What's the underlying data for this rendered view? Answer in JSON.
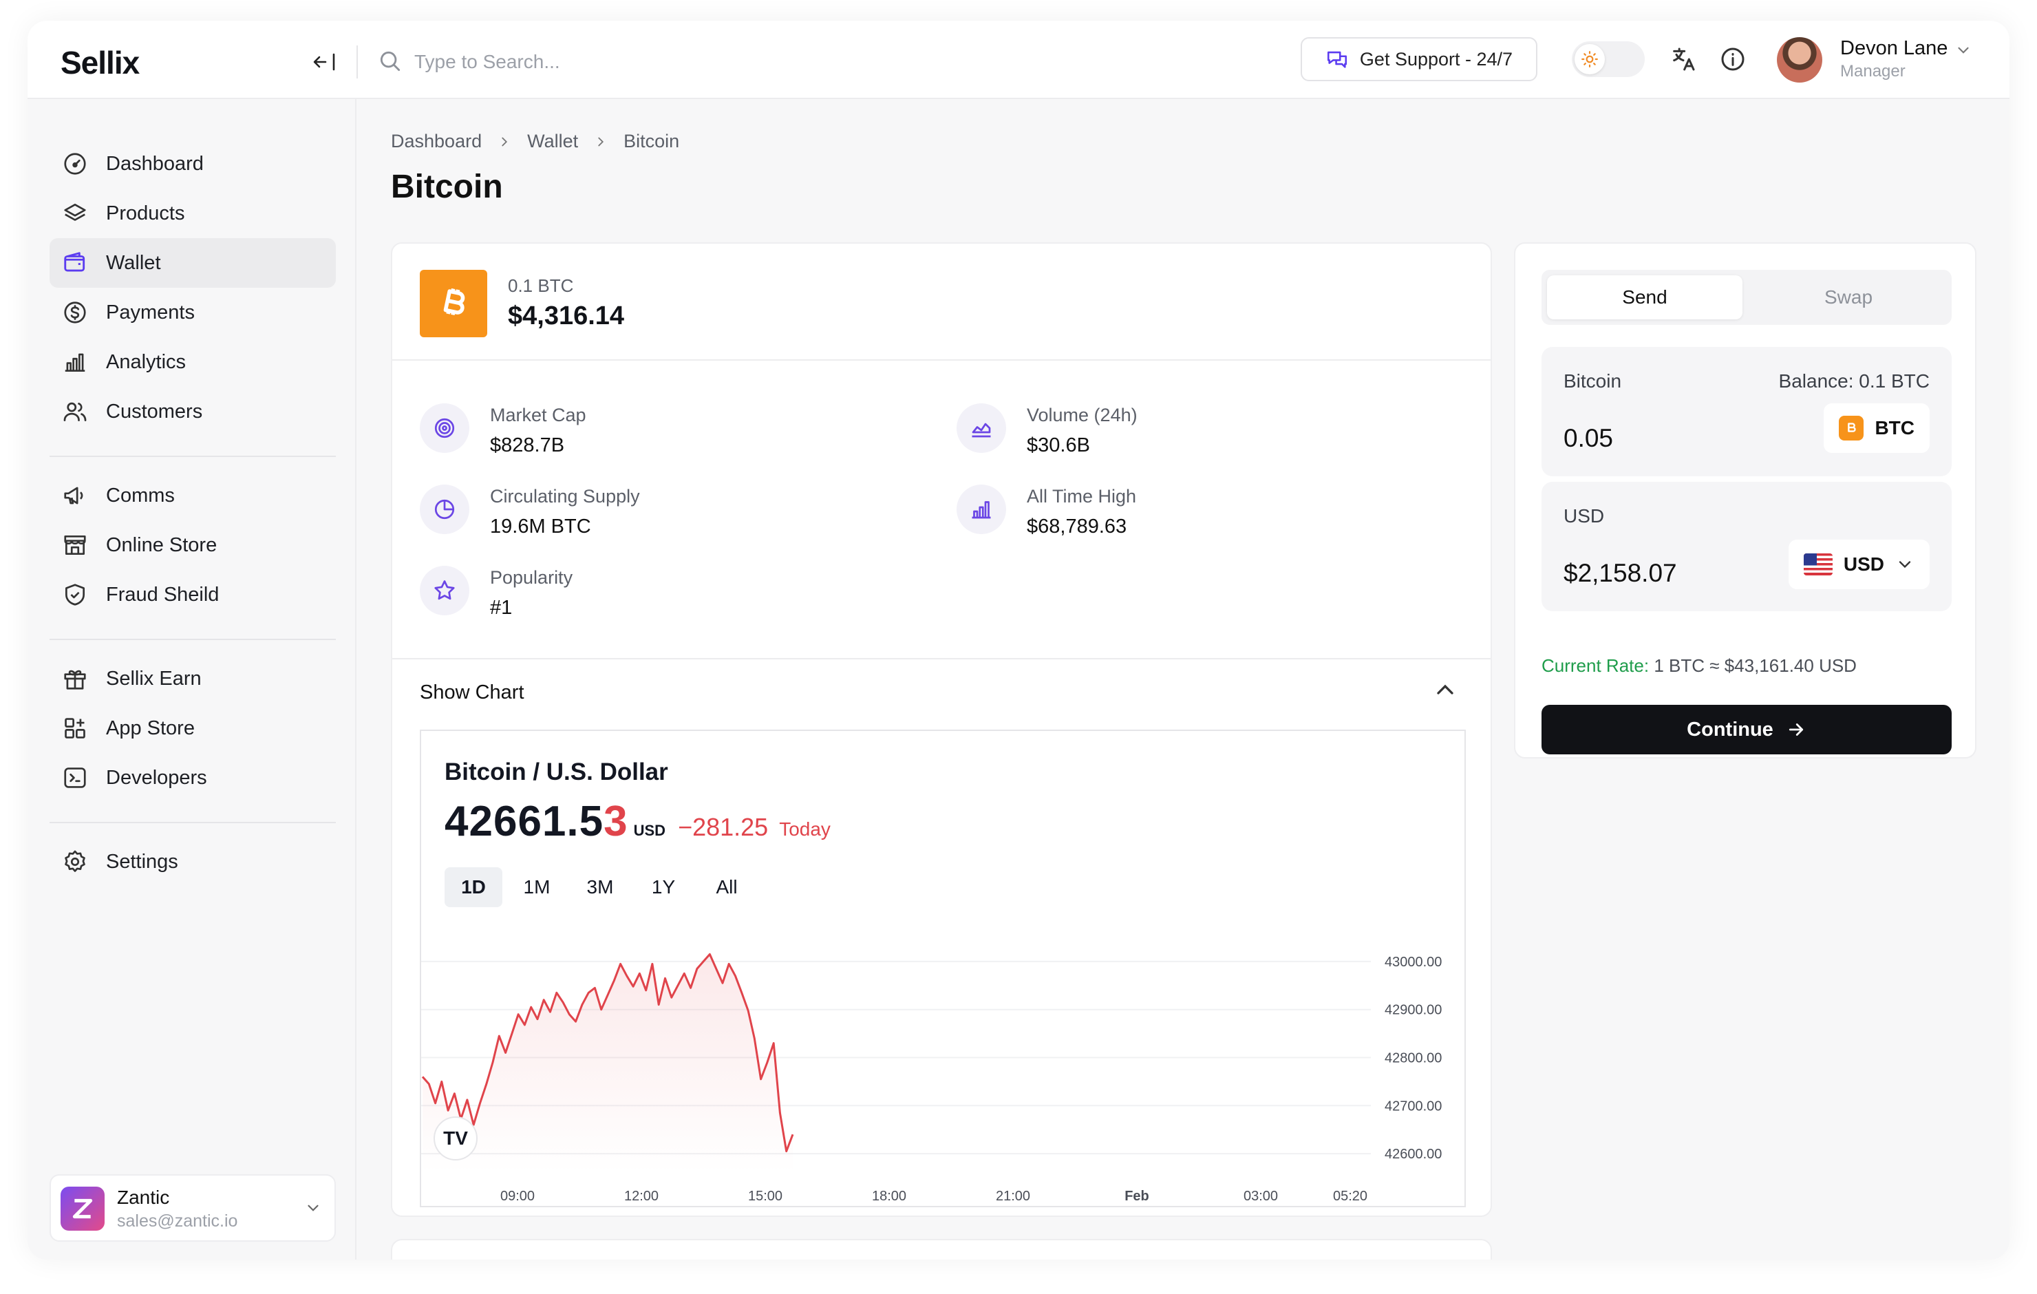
{
  "app": {
    "logo": "Sellix"
  },
  "topbar": {
    "search_placeholder": "Type to Search...",
    "support_label": "Get Support - 24/7",
    "user_name": "Devon Lane",
    "user_role": "Manager"
  },
  "sidebar": {
    "items": [
      {
        "label": "Dashboard",
        "icon": "dashboard-icon"
      },
      {
        "label": "Products",
        "icon": "layers-icon"
      },
      {
        "label": "Wallet",
        "icon": "wallet-icon"
      },
      {
        "label": "Payments",
        "icon": "dollar-circle-icon"
      },
      {
        "label": "Analytics",
        "icon": "bar-chart-icon"
      },
      {
        "label": "Customers",
        "icon": "users-icon"
      },
      {
        "label": "Comms",
        "icon": "megaphone-icon"
      },
      {
        "label": "Online Store",
        "icon": "store-icon"
      },
      {
        "label": "Fraud Sheild",
        "icon": "shield-icon"
      },
      {
        "label": "Sellix Earn",
        "icon": "gift-icon"
      },
      {
        "label": "App Store",
        "icon": "apps-icon"
      },
      {
        "label": "Developers",
        "icon": "terminal-icon"
      },
      {
        "label": "Settings",
        "icon": "gear-icon"
      }
    ],
    "active": "Wallet",
    "org": {
      "name": "Zantic",
      "email": "sales@zantic.io"
    }
  },
  "breadcrumb": [
    "Dashboard",
    "Wallet",
    "Bitcoin"
  ],
  "page_title": "Bitcoin",
  "wallet": {
    "amount": "0.1 BTC",
    "value": "$4,316.14",
    "stats": {
      "market_cap": {
        "label": "Market Cap",
        "value": "$828.7B"
      },
      "volume": {
        "label": "Volume (24h)",
        "value": "$30.6B"
      },
      "supply": {
        "label": "Circulating Supply",
        "value": "19.6M BTC"
      },
      "ath": {
        "label": "All Time High",
        "value": "$68,789.63"
      },
      "popularity": {
        "label": "Popularity",
        "value": "#1"
      }
    },
    "show_chart_label": "Show Chart"
  },
  "chart": {
    "title": "Bitcoin / U.S. Dollar",
    "price_main": "42661.5",
    "price_last_digit": "3",
    "price_unit": "USD",
    "change": "−281.25",
    "change_period": "Today",
    "ranges": [
      "1D",
      "1M",
      "3M",
      "1Y",
      "All"
    ],
    "active_range": "1D",
    "logo_text": "TV"
  },
  "chart_data": {
    "type": "line",
    "title": "Bitcoin / U.S. Dollar",
    "x_ticks": [
      "09:00",
      "12:00",
      "15:00",
      "18:00",
      "21:00",
      "Feb",
      "03:00",
      "05:20"
    ],
    "y_ticks": [
      "43000.00",
      "42900.00",
      "42800.00",
      "42700.00",
      "42600.00"
    ],
    "ylim": [
      42560,
      43050
    ],
    "series": [
      {
        "color": "#e0444b",
        "values": [
          42760,
          42745,
          42705,
          42750,
          42690,
          42725,
          42672,
          42712,
          42660,
          42705,
          42745,
          42790,
          42845,
          42810,
          42850,
          42890,
          42868,
          42905,
          42880,
          42920,
          42895,
          42935,
          42915,
          42890,
          42875,
          42910,
          42935,
          42945,
          42900,
          42930,
          42960,
          42995,
          42970,
          42948,
          42975,
          42940,
          42995,
          42910,
          42965,
          42925,
          42950,
          42975,
          42945,
          42985,
          43000,
          43015,
          42985,
          42955,
          42995,
          42970,
          42935,
          42898,
          42840,
          42755,
          42790,
          42830,
          42685,
          42605,
          42640
        ]
      }
    ]
  },
  "send": {
    "tabs": [
      "Send",
      "Swap"
    ],
    "active_tab": "Send",
    "from_label": "Bitcoin",
    "balance": "Balance: 0.1 BTC",
    "from_value": "0.05",
    "from_coin": "BTC",
    "to_label": "USD",
    "to_value": "$2,158.07",
    "to_currency": "USD",
    "rate_label": "Current Rate:",
    "rate_value": "1 BTC ≈ $43,161.40 USD",
    "continue_label": "Continue"
  }
}
